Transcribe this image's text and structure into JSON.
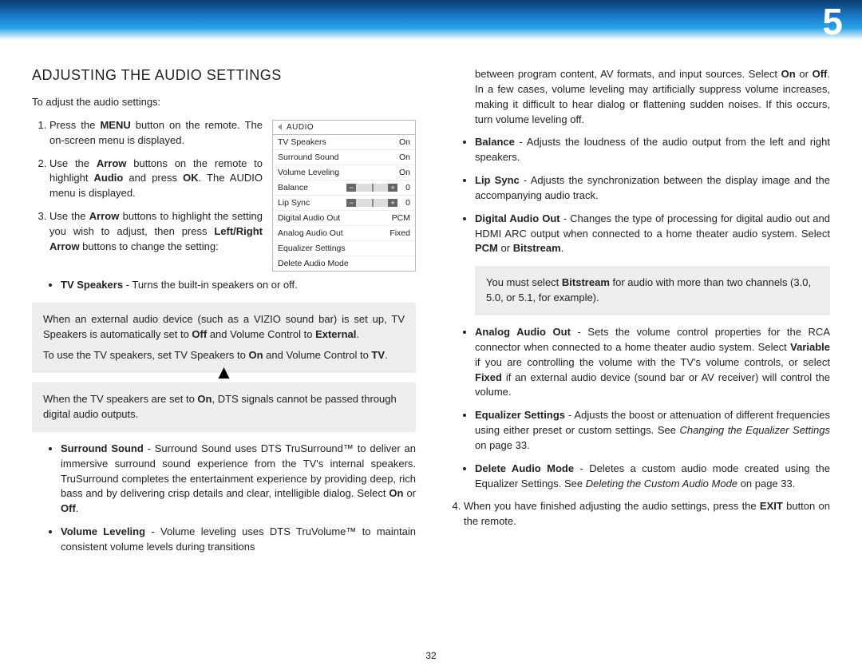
{
  "chapter_num": "5",
  "page_num": "32",
  "section_title": "ADJUSTING THE AUDIO SETTINGS",
  "intro": "To adjust the audio settings:",
  "menu": {
    "title": "AUDIO",
    "rows": [
      {
        "label": "TV Speakers",
        "value": "On",
        "type": "text"
      },
      {
        "label": "Surround Sound",
        "value": "On",
        "type": "text"
      },
      {
        "label": "Volume Leveling",
        "value": "On",
        "type": "text"
      },
      {
        "label": "Balance",
        "value": "0",
        "type": "slider"
      },
      {
        "label": "Lip Sync",
        "value": "0",
        "type": "slider"
      },
      {
        "label": "Digital Audio Out",
        "value": "PCM",
        "type": "text"
      },
      {
        "label": "Analog Audio Out",
        "value": "Fixed",
        "type": "text"
      },
      {
        "label": "Equalizer Settings",
        "value": "",
        "type": "text"
      },
      {
        "label": "Delete Audio Mode",
        "value": "",
        "type": "text"
      }
    ]
  },
  "steps": {
    "s1_a": "Press the ",
    "s1_menu": "MENU",
    "s1_b": " button on the remote. The on-screen menu is displayed.",
    "s2_a": "Use the ",
    "s2_arrow": "Arrow",
    "s2_b": " buttons on the remote to highlight ",
    "s2_audio": "Audio",
    "s2_c": " and press ",
    "s2_ok": "OK",
    "s2_d": ". The AUDIO menu is displayed.",
    "s3_a": "Use the ",
    "s3_arrow": "Arrow",
    "s3_b": " buttons to highlight the setting you wish to adjust, then press ",
    "s3_lr": "Left/Right Arrow",
    "s3_c": " buttons to change the setting:"
  },
  "tvspeakers": {
    "label": "TV Speakers",
    "text": " - Turns the built-in speakers on or off."
  },
  "note1": {
    "p1_a": "When an external audio device (such as a VIZIO sound bar) is set up, TV Speakers is automatically set to ",
    "p1_off": "Off",
    "p1_b": " and Volume Control to ",
    "p1_ext": "External",
    "p1_c": ".",
    "p2_a": "To use the TV speakers, set TV Speakers to ",
    "p2_on": "On",
    "p2_b": " and Volume Control to ",
    "p2_tv": "TV",
    "p2_c": "."
  },
  "warn": {
    "a": "When the TV speakers are set to ",
    "on": "On",
    "b": ", DTS signals cannot be passed through digital audio outputs."
  },
  "surround": {
    "label": "Surround Sound",
    "text": " - Surround Sound uses DTS TruSurround™ to deliver an immersive surround sound experience from the TV's internal speakers. TruSurround completes the entertainment experience by providing deep, rich bass and by delivering crisp details and clear, intelligible dialog. Select ",
    "on": "On",
    "or": " or ",
    "off": "Off",
    "end": "."
  },
  "vollevel": {
    "label": "Volume Leveling",
    "text": " - Volume leveling uses DTS TruVolume™ to maintain consistent volume levels during transitions "
  },
  "vollevel_cont": {
    "a": "between program content, AV formats, and input sources. Select ",
    "on": "On",
    "or": " or ",
    "off": "Off",
    "b": ". In a few cases, volume leveling may artificially suppress volume increases, making it difficult to hear dialog or flattening sudden noises. If this occurs, turn volume leveling off."
  },
  "balance": {
    "label": "Balance",
    "text": " - Adjusts the loudness of the audio output from the left and right speakers."
  },
  "lipsync": {
    "label": "Lip Sync",
    "text": " - Adjusts the synchronization between the display image and the accompanying audio track."
  },
  "dao": {
    "label": "Digital Audio Out",
    "text": " - Changes the type of processing for digital audio out and  HDMI ARC output when connected to a home theater audio system. Select ",
    "pcm": "PCM",
    "or": " or ",
    "bit": "Bitstream",
    "end": "."
  },
  "dao_note": {
    "a": "You must select ",
    "bit": "Bitstream",
    "b": " for audio with more than two channels (3.0, 5.0, or 5.1, for example)."
  },
  "aao": {
    "label": "Analog Audio Out",
    "text_a": " - Sets the volume control properties for the RCA connector when connected to a home theater audio system. Select ",
    "var": "Variable",
    "text_b": " if you are controlling the volume with the TV's volume controls, or select ",
    "fixed": "Fixed",
    "text_c": " if an external audio device (sound bar or AV receiver) will control the volume."
  },
  "eq": {
    "label": "Equalizer Settings",
    "text": " - Adjusts the boost or attenuation of different frequencies using either preset or custom settings. See ",
    "ref": "Changing the Equalizer Settings",
    "pg": " on page 33."
  },
  "del": {
    "label": "Delete Audio Mode",
    "text": " - Deletes a custom audio mode created using the Equalizer Settings. See ",
    "ref": "Deleting the Custom Audio Mode",
    "pg": " on page 33."
  },
  "s4": {
    "a": "When you have finished adjusting the audio settings, press the ",
    "exit": "EXIT",
    "b": " button on the remote."
  }
}
